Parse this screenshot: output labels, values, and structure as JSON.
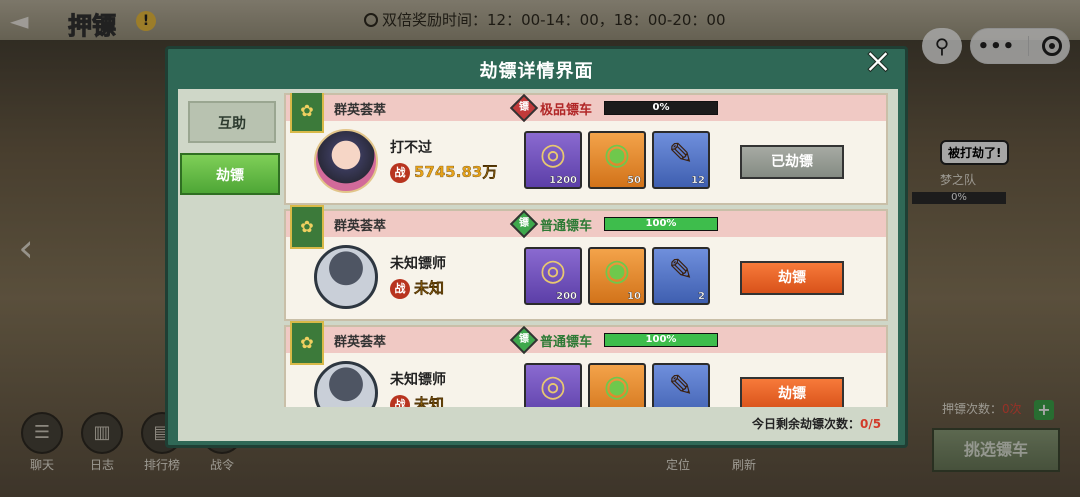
{
  "game": {
    "title": "押镖",
    "info_icon": "!",
    "double_reward": "双倍奖励时间：12：00-14：00，18：00-20：00",
    "back_icon": "back-arrow-icon"
  },
  "mini_program": {
    "profile_icon": "⚲",
    "more_icon": "•••"
  },
  "bottom_menu": [
    {
      "label": "聊天",
      "icon": "chat-icon"
    },
    {
      "label": "日志",
      "icon": "book-icon"
    },
    {
      "label": "排行榜",
      "icon": "ranking-icon"
    },
    {
      "label": "战令",
      "icon": "battle-pass-icon"
    }
  ],
  "map_controls": {
    "locate": "定位",
    "refresh": "刷新"
  },
  "enemy_preview": {
    "bubble": "被打劫了!",
    "name": "梦之队",
    "hp": "0%"
  },
  "escort": {
    "count_label": "押镖次数：",
    "count_value": "0次",
    "plus": "+",
    "select_cart": "挑选镖车"
  },
  "modal": {
    "title": "劫镖详情界面",
    "close": "✕",
    "tabs": [
      {
        "label": "互助",
        "active": false
      },
      {
        "label": "劫镖",
        "active": true
      }
    ],
    "remaining_label": "今日剩余劫镖次数：",
    "remaining_value": "0/5",
    "cards": [
      {
        "team": "群英荟萃",
        "cart_type": "极品镖车",
        "cart_kind": "premium",
        "hp_text": "0%",
        "hp_fraction": 0.0,
        "player_name": "打不过",
        "power_icon": "战",
        "power": "5745.83万",
        "avatar": "known",
        "items": [
          {
            "kind": "coin",
            "glyph": "◎",
            "count": "1200"
          },
          {
            "kind": "jade",
            "glyph": "◉",
            "count": "50"
          },
          {
            "kind": "brush",
            "glyph": "✎",
            "count": "12"
          }
        ],
        "button": "已劫镖",
        "button_state": "done"
      },
      {
        "team": "群英荟萃",
        "cart_type": "普通镖车",
        "cart_kind": "normal",
        "hp_text": "100%",
        "hp_fraction": 1.0,
        "player_name": "未知镖师",
        "power_icon": "战",
        "power": "未知",
        "avatar": "unknown",
        "items": [
          {
            "kind": "coin",
            "glyph": "◎",
            "count": "200"
          },
          {
            "kind": "jade",
            "glyph": "◉",
            "count": "10"
          },
          {
            "kind": "brush",
            "glyph": "✎",
            "count": "2"
          }
        ],
        "button": "劫镖",
        "button_state": "go"
      },
      {
        "team": "群英荟萃",
        "cart_type": "普通镖车",
        "cart_kind": "normal",
        "hp_text": "100%",
        "hp_fraction": 1.0,
        "player_name": "未知镖师",
        "power_icon": "战",
        "power": "未知",
        "avatar": "unknown",
        "items": [
          {
            "kind": "coin",
            "glyph": "◎",
            "count": ""
          },
          {
            "kind": "jade",
            "glyph": "◉",
            "count": ""
          },
          {
            "kind": "brush",
            "glyph": "✎",
            "count": ""
          }
        ],
        "button": "劫镖",
        "button_state": "go"
      }
    ]
  }
}
